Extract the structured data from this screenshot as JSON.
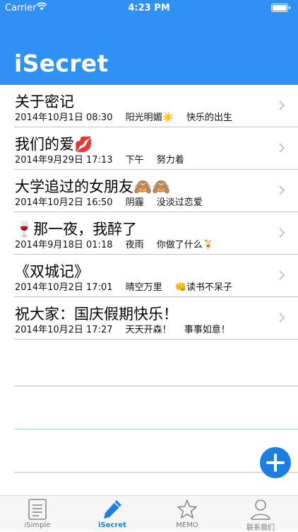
{
  "status_bar": {
    "carrier": "Carrier",
    "time": "4:23 PM"
  },
  "header": {
    "title": "iSecret"
  },
  "entries": [
    {
      "title": "关于密记",
      "emoji": "",
      "date": "2014年10月1日 08:30",
      "weather": "阳光明媚☀️",
      "mood": "快乐的出生"
    },
    {
      "title": "我们的爱💋",
      "emoji": "",
      "date": "2014年9月29日 17:13",
      "weather": "下午",
      "mood": "努力着"
    },
    {
      "title": "大学追过的女朋友🙈🙈",
      "emoji": "",
      "date": "2014年10月2日 16:50",
      "weather": "阴霾",
      "mood": "没淡过恋爱"
    },
    {
      "title": "🍷那一夜，我醉了",
      "emoji": "",
      "date": "2014年9月18日 01:18",
      "weather": "夜雨",
      "mood": "你做了什么🍹"
    },
    {
      "title": "《双城记》",
      "emoji": "",
      "date": "2014年10月2日 17:01",
      "weather": "晴空万里",
      "mood": "👊读书不呆子"
    },
    {
      "title": "祝大家：国庆假期快乐！",
      "emoji": "",
      "date": "2014年10月2日 17:27",
      "weather": "天天开森！",
      "mood": "事事如意！"
    }
  ],
  "tabs": [
    {
      "label": "iSimple",
      "icon": "document-icon"
    },
    {
      "label": "iSecret",
      "icon": "pencil-icon"
    },
    {
      "label": "MEMO",
      "icon": "star-icon"
    },
    {
      "label": "联系我们",
      "icon": "person-icon"
    }
  ],
  "colors": {
    "accent": "#2e91f3",
    "separator": "#a9c7e6",
    "fab": "#1e7fe0"
  }
}
